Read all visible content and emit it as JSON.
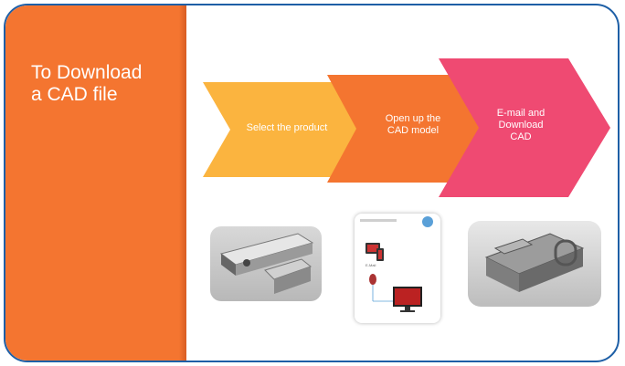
{
  "slide": {
    "title": "To Download\na CAD file",
    "steps": [
      {
        "label": "Select the product",
        "color": "#fbb43f"
      },
      {
        "label": "Open up the\nCAD model",
        "color": "#f47530"
      },
      {
        "label": "E-mail and\nDownload\nCAD",
        "color": "#ef4a72"
      }
    ],
    "images": [
      {
        "name": "linear-actuator-product-photo"
      },
      {
        "name": "device-flow-diagram-card"
      },
      {
        "name": "cad-model-render"
      }
    ],
    "colors": {
      "frame_border": "#1e5fa6",
      "sidebar": "#f47530"
    }
  }
}
